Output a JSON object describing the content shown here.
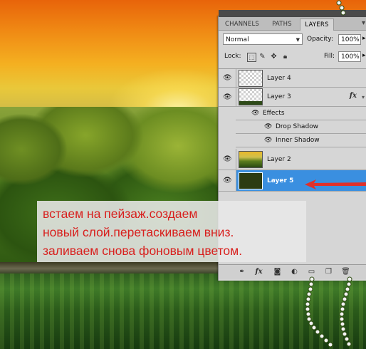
{
  "panel": {
    "tabs": [
      {
        "label": "CHANNELS",
        "active": false
      },
      {
        "label": "PATHS",
        "active": false
      },
      {
        "label": "LAYERS",
        "active": true
      }
    ],
    "blend_mode": "Normal",
    "opacity_label": "Opacity:",
    "opacity_value": "100%",
    "lock_label": "Lock:",
    "fill_label": "Fill:",
    "fill_value": "100%",
    "layers": [
      {
        "name": "Layer 4",
        "thumbnail": "transparent"
      },
      {
        "name": "Layer 3",
        "thumbnail": "transparent-with-strip",
        "has_fx": true,
        "effects_label": "Effects",
        "effects": [
          "Drop Shadow",
          "Inner Shadow"
        ]
      },
      {
        "name": "Layer 2",
        "thumbnail": "landscape"
      },
      {
        "name": "Layer 5",
        "thumbnail": "dark-green-fill",
        "selected": true
      }
    ],
    "fx_label": "fx",
    "bottom_icons": [
      "link-icon",
      "fx-icon",
      "mask-icon",
      "adjustment-icon",
      "folder-icon",
      "new-layer-icon",
      "trash-icon"
    ]
  },
  "note": {
    "lines": [
      "встаем на пейзаж.создаем",
      "новый слой.перетаскиваем вниз.",
      "заливаем снова фоновым цветом."
    ]
  },
  "colors": {
    "selection": "#3a8fe0",
    "annotation_text": "#d8201e",
    "arrow": "#e0302a"
  }
}
